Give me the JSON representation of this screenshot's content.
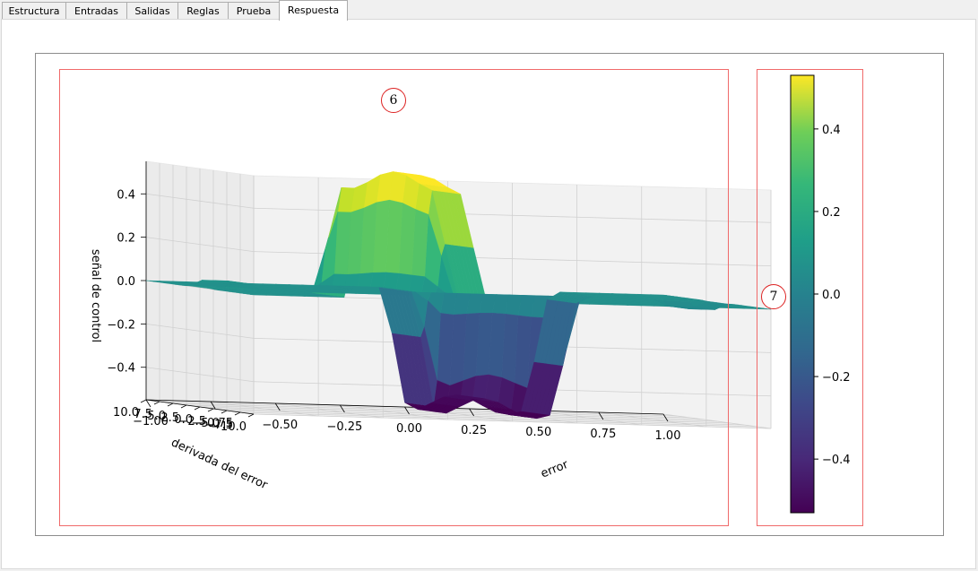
{
  "tabs": [
    {
      "label": "Estructura"
    },
    {
      "label": "Entradas"
    },
    {
      "label": "Salidas"
    },
    {
      "label": "Reglas"
    },
    {
      "label": "Prueba"
    },
    {
      "label": "Respuesta",
      "active": true
    }
  ],
  "markers": {
    "surface": "6",
    "colorbar": "7"
  },
  "colors": {
    "accent_box": "#f06a6a",
    "marker_ring": "#dd2222"
  },
  "chart_data": [
    {
      "type": "surface3d",
      "title": "",
      "xlabel": "error",
      "ylabel": "derivada del error",
      "zlabel": "señal de control",
      "xlim": [
        -1,
        1
      ],
      "ylim": [
        10,
        -10
      ],
      "zlim": [
        -0.55,
        0.55
      ],
      "xticks": [
        "−1.00",
        "−0.75",
        "−0.50",
        "−0.25",
        "0.00",
        "0.25",
        "0.50",
        "0.75",
        "1.00"
      ],
      "yticks": [
        "10.0",
        "7.5",
        "5.0",
        "2.5",
        "0.0",
        "−2.5",
        "−5.0",
        "−7.5",
        "−10.0"
      ],
      "zticks": [
        "0.4",
        "0.2",
        "0.0",
        "−0.2",
        "−0.4"
      ],
      "colormap": "viridis",
      "surface": {
        "plateau_flat": 0.0,
        "positive_peak": {
          "value": 0.53,
          "error_range": [
            -0.5,
            -0.25
          ],
          "derivative_range": [
            5,
            10
          ]
        },
        "negative_trough": {
          "value": -0.53,
          "error_range": [
            0.0,
            0.5
          ],
          "derivative_range": [
            -10,
            -5
          ]
        }
      }
    },
    {
      "type": "colorbar",
      "colormap": "viridis",
      "range": [
        -0.53,
        0.53
      ],
      "ticks": [
        "0.4",
        "0.2",
        "0.0",
        "−0.2",
        "−0.4"
      ],
      "tick_values": [
        0.4,
        0.2,
        0.0,
        -0.2,
        -0.4
      ]
    }
  ]
}
